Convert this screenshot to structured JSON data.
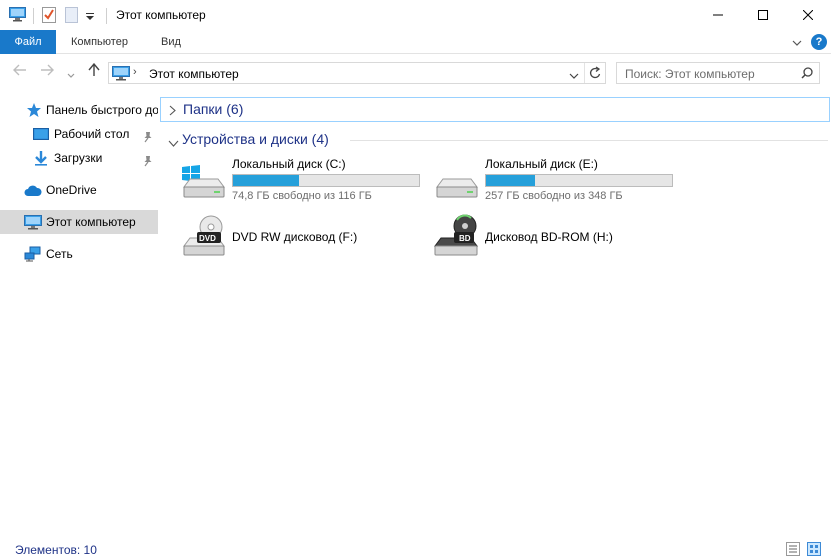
{
  "window": {
    "title": "Этот компьютер"
  },
  "ribbon": {
    "tabs": [
      "Файл",
      "Компьютер",
      "Вид"
    ]
  },
  "navigation": {
    "address_path": "Этот компьютер",
    "search_placeholder": "Поиск: Этот компьютер"
  },
  "sidebar": {
    "items": [
      {
        "label": "Панель быстрого доступа",
        "icon": "star-icon",
        "pinned": false
      },
      {
        "label": "Рабочий стол",
        "icon": "desktop-icon",
        "pinned": true
      },
      {
        "label": "Загрузки",
        "icon": "downloads-icon",
        "pinned": true
      },
      {
        "label": "OneDrive",
        "icon": "cloud-icon",
        "pinned": false
      },
      {
        "label": "Этот компьютер",
        "icon": "computer-icon",
        "pinned": false,
        "selected": true
      },
      {
        "label": "Сеть",
        "icon": "network-icon",
        "pinned": false
      }
    ]
  },
  "groups": {
    "folders": {
      "label": "Папки (6)",
      "expanded": false
    },
    "devices": {
      "label": "Устройства и диски (4)",
      "expanded": true
    }
  },
  "drives": [
    {
      "name": "Локальный диск (C:)",
      "free_text": "74,8 ГБ свободно из 116 ГБ",
      "used_fraction": 0.355,
      "icon": "windows-drive-icon"
    },
    {
      "name": "Локальный диск (E:)",
      "free_text": "257 ГБ свободно из 348 ГБ",
      "used_fraction": 0.262,
      "icon": "hard-drive-icon"
    },
    {
      "name": "DVD RW дисковод (F:)",
      "icon": "dvd-drive-icon",
      "badge": "DVD"
    },
    {
      "name": "Дисковод BD-ROM (H:)",
      "icon": "bd-drive-icon",
      "badge": "BD"
    }
  ],
  "status": {
    "items_text": "Элементов: 10"
  },
  "colors": {
    "accent": "#1979ca",
    "bar_fill": "#26a0da",
    "group_text": "#1e3287",
    "selected_bg": "#d9d9d9"
  }
}
